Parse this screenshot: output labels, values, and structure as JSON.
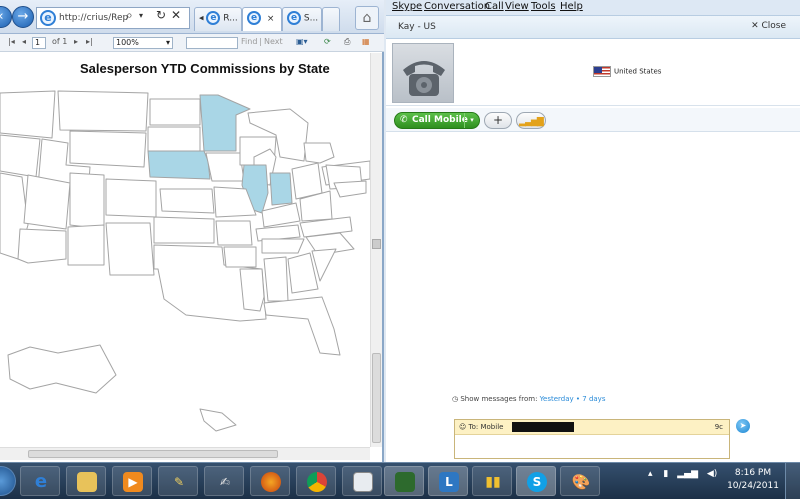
{
  "browser": {
    "address": "http://crius/Rep",
    "tabs": [
      {
        "label": "R...",
        "close": "×"
      },
      {
        "label": "",
        "close": "×"
      },
      {
        "label": "S..."
      }
    ],
    "report_toolbar": {
      "page_value": "1",
      "page_of": "of 1",
      "zoom": "100%",
      "find_label": "Find",
      "separator": "|",
      "next_label": "Next"
    },
    "report": {
      "title": "Salesperson YTD Commissions by State",
      "highlight_color": "#a9d6e6",
      "highlighted_states": [
        "Minnesota",
        "Nebraska",
        "Illinois",
        "Indiana"
      ]
    }
  },
  "skype": {
    "menu": [
      "Skype",
      "Conversation",
      "Call",
      "View",
      "Tools",
      "Help"
    ],
    "contact_name": "Kay - US",
    "close_label": "Close",
    "country": "United States",
    "call_button": "Call Mobile",
    "show_messages": {
      "label": "Show messages from:",
      "yesterday": "Yesterday",
      "bullet": "•",
      "seven_days": "7 days"
    },
    "compose": {
      "to_label": "To: Mobile",
      "char_count": "9c"
    }
  },
  "taskbar": {
    "time": "8:16 PM",
    "date": "10/24/2011",
    "items": [
      "windows-start",
      "internet-explorer",
      "file-explorer",
      "media-player",
      "app-pen",
      "app-notes",
      "firefox",
      "chrome",
      "app-window",
      "app-terminal",
      "lync",
      "app-chart",
      "skype",
      "paint"
    ]
  }
}
